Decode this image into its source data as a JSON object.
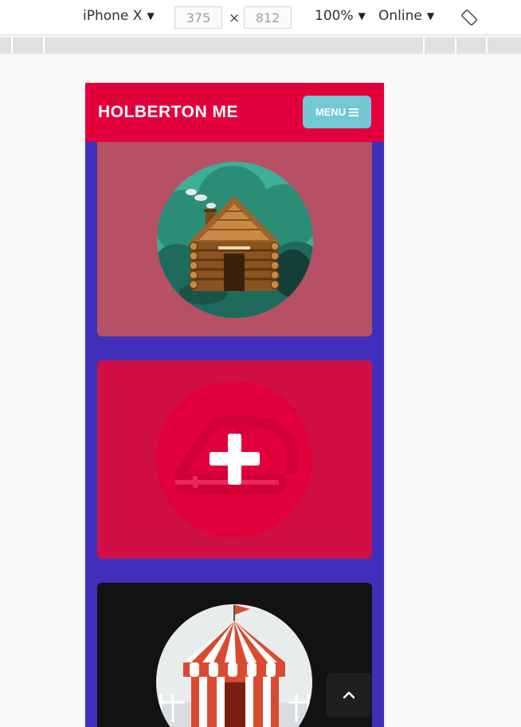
{
  "devtools": {
    "device": "iPhone X",
    "width": "375",
    "height": "812",
    "times": "×",
    "zoom": "100%",
    "network": "Online",
    "caret": "▼"
  },
  "site": {
    "brand": "HOLBERTON ME",
    "menu_label": "MENU"
  },
  "cards": [
    {
      "image": "log-cabin-icon"
    },
    {
      "image": "add-icon"
    },
    {
      "image": "circus-tent-icon"
    }
  ],
  "colors": {
    "header": "#e2003c",
    "menu_button": "#74c7d4",
    "page_background": "#412fbc"
  }
}
